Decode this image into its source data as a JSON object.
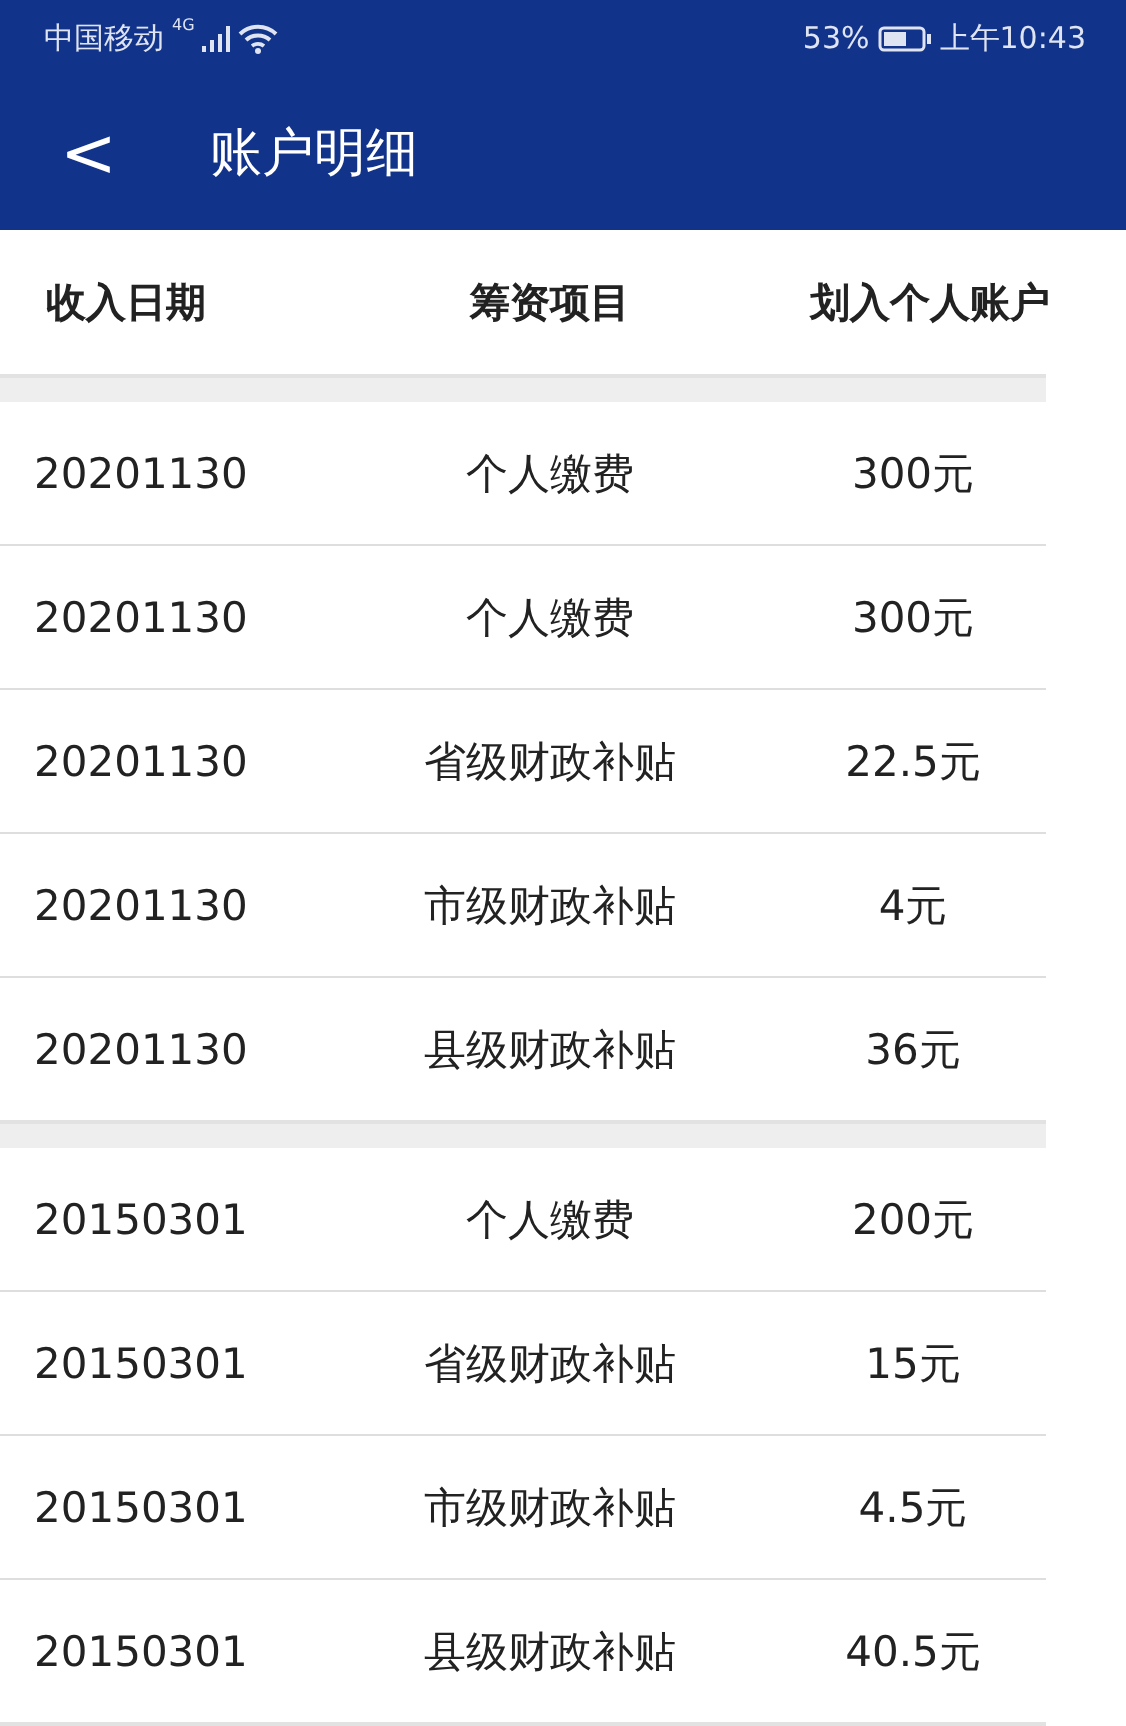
{
  "status_bar": {
    "carrier": "中国移动",
    "network": "4G",
    "battery_percent": "53%",
    "time": "上午10:43"
  },
  "nav": {
    "back": "<",
    "title": "账户明细"
  },
  "table": {
    "columns": [
      "收入日期",
      "筹资项目",
      "划入个人账户"
    ],
    "groups": [
      {
        "rows": [
          {
            "date": "20201130",
            "item": "个人缴费",
            "amount": "300元"
          },
          {
            "date": "20201130",
            "item": "个人缴费",
            "amount": "300元"
          },
          {
            "date": "20201130",
            "item": "省级财政补贴",
            "amount": "22.5元"
          },
          {
            "date": "20201130",
            "item": "市级财政补贴",
            "amount": "4元"
          },
          {
            "date": "20201130",
            "item": "县级财政补贴",
            "amount": "36元"
          }
        ]
      },
      {
        "rows": [
          {
            "date": "20150301",
            "item": "个人缴费",
            "amount": "200元"
          },
          {
            "date": "20150301",
            "item": "省级财政补贴",
            "amount": "15元"
          },
          {
            "date": "20150301",
            "item": "市级财政补贴",
            "amount": "4.5元"
          },
          {
            "date": "20150301",
            "item": "县级财政补贴",
            "amount": "40.5元"
          }
        ]
      }
    ]
  }
}
